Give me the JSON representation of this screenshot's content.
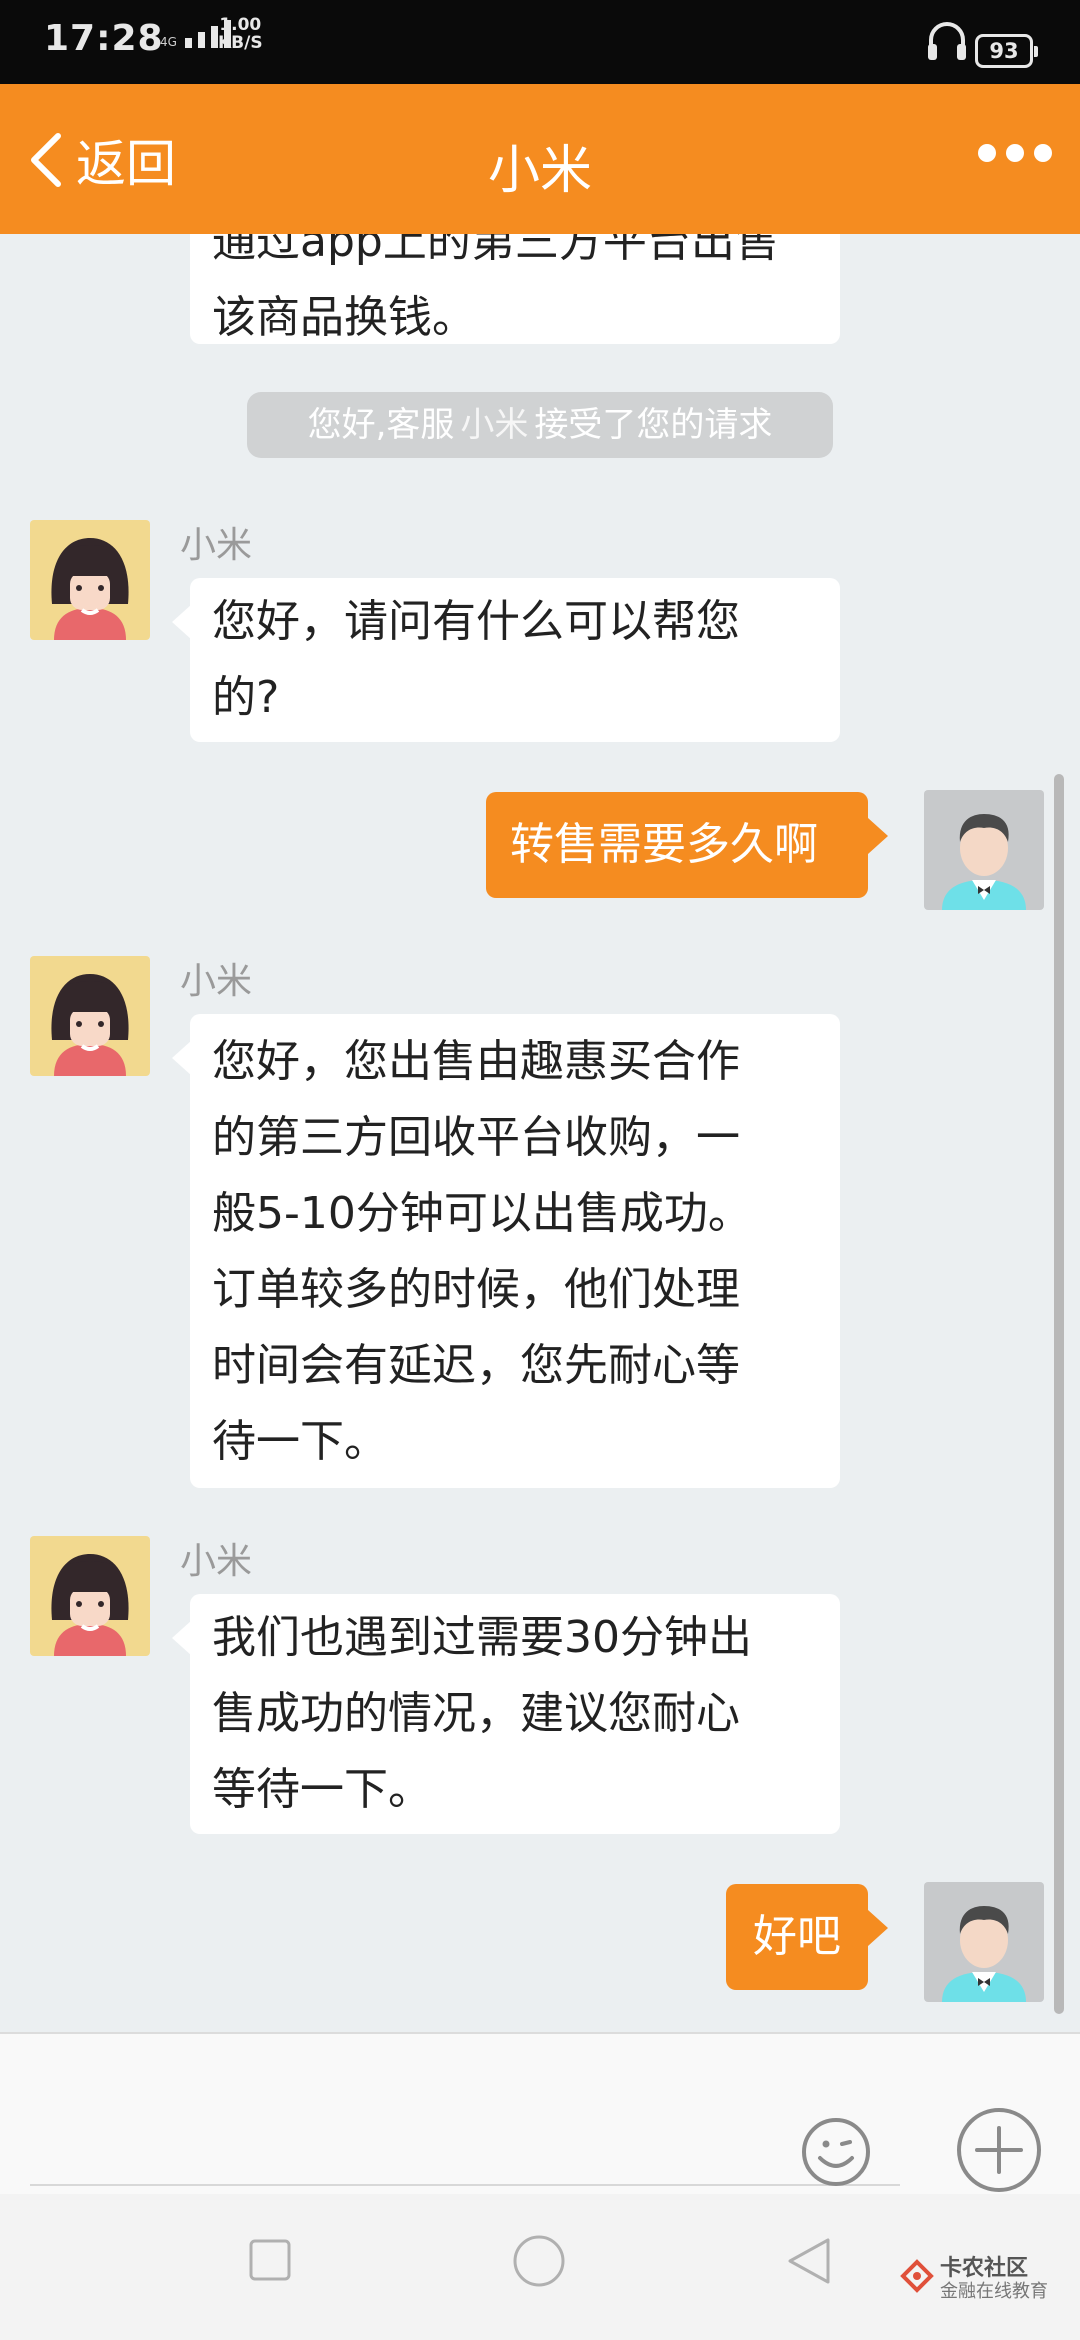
{
  "status_bar": {
    "time": "17:28",
    "network_type": "4G",
    "speed_value": "1.00",
    "speed_unit": "KB/S",
    "battery": "93"
  },
  "header": {
    "back_label": "返回",
    "title": "小米"
  },
  "messages": [
    {
      "kind": "incoming-partial",
      "lines": [
        "通过app上的第三方平台出售",
        "该商品换钱。"
      ]
    },
    {
      "kind": "system",
      "prefix": "您好,客服",
      "agent": "小米",
      "suffix": "接受了您的请求"
    },
    {
      "kind": "incoming",
      "sender": "小米",
      "lines": [
        "您好，请问有什么可以帮您",
        "的?"
      ]
    },
    {
      "kind": "outgoing",
      "text": "转售需要多久啊"
    },
    {
      "kind": "incoming",
      "sender": "小米",
      "lines": [
        "您好，您出售由趣惠买合作",
        "的第三方回收平台收购，一",
        "般5-10分钟可以出售成功。",
        "订单较多的时候，他们处理",
        "时间会有延迟，您先耐心等",
        "待一下。"
      ]
    },
    {
      "kind": "incoming",
      "sender": "小米",
      "lines": [
        "我们也遇到过需要30分钟出",
        "售成功的情况，建议您耐心",
        "等待一下。"
      ]
    },
    {
      "kind": "outgoing",
      "text": "好吧"
    }
  ],
  "icons": {
    "back": "chevron-left-icon",
    "more": "more-dots-icon",
    "emoji": "emoji-icon",
    "plus": "plus-circle-icon",
    "headset": "headset-icon"
  },
  "colors": {
    "brand": "#f58c20",
    "chat_background": "#ebeff1",
    "system_notice": "#d0d2d3"
  },
  "watermark": {
    "title": "卡农社区",
    "subtitle": "金融在线教育"
  }
}
